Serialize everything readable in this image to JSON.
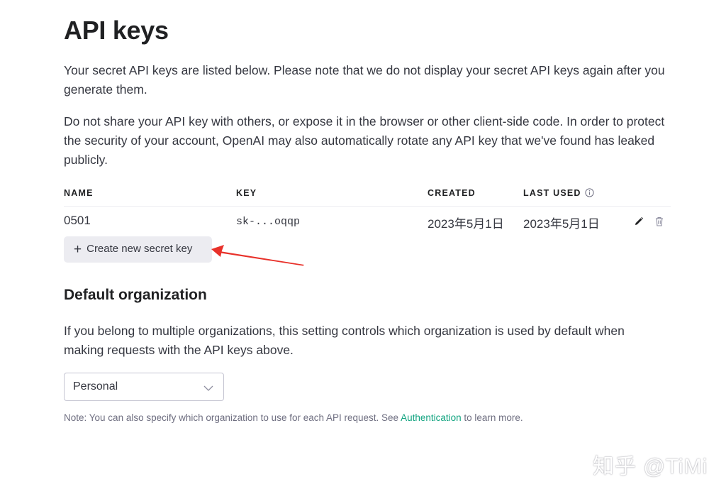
{
  "page": {
    "title": "API keys",
    "intro": "Your secret API keys are listed below. Please note that we do not display your secret API keys again after you generate them.",
    "warning": "Do not share your API key with others, or expose it in the browser or other client-side code. In order to protect the security of your account, OpenAI may also automatically rotate any API key that we've found has leaked publicly."
  },
  "keys_table": {
    "headers": {
      "name": "NAME",
      "key": "KEY",
      "created": "CREATED",
      "last_used": "LAST USED"
    },
    "rows": [
      {
        "name": "0501",
        "key": "sk-...oqqp",
        "created": "2023年5月1日",
        "last_used": "2023年5月1日"
      }
    ]
  },
  "create_button": {
    "plus": "+",
    "label": "Create new secret key"
  },
  "default_org": {
    "heading": "Default organization",
    "description": "If you belong to multiple organizations, this setting controls which organization is used by default when making requests with the API keys above.",
    "selected": "Personal",
    "note_prefix": "Note: You can also specify which organization to use for each API request. See ",
    "note_link": "Authentication",
    "note_suffix": " to learn more."
  },
  "watermark": "知乎 @TiMi",
  "colors": {
    "accent_link": "#10a37f",
    "arrow": "#e8312a",
    "button_bg": "#ececf1"
  },
  "icons": {
    "info": "info-icon",
    "edit": "pencil-icon",
    "delete": "trash-icon",
    "select": "chevron-down-icon"
  }
}
